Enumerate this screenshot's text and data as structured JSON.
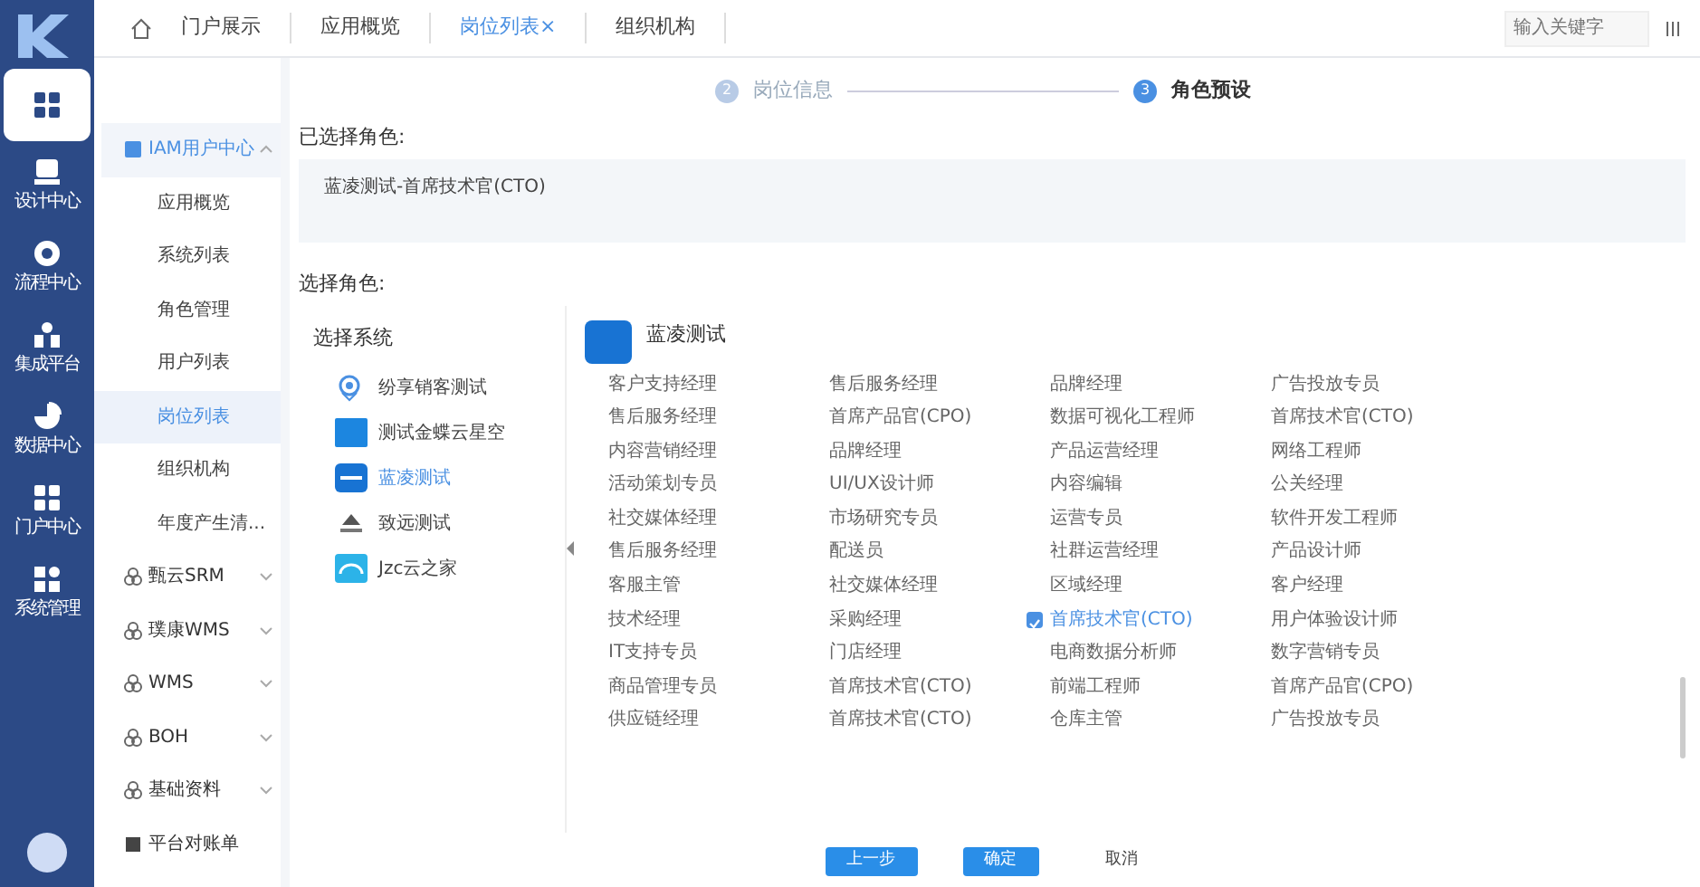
{
  "rail": {
    "items": [
      {
        "selected": true
      },
      {
        "label": "设计中心",
        "selected": false
      },
      {
        "label": "流程中心",
        "selected": false
      },
      {
        "label": "集成平台",
        "selected": false
      },
      {
        "label": "数据中心",
        "selected": false
      },
      {
        "label": "门户中心",
        "selected": false
      },
      {
        "label": "系统管理",
        "selected": false
      }
    ]
  },
  "tabs": [
    {
      "label": "门户展示",
      "selected": false
    },
    {
      "label": "应用概览",
      "selected": false
    },
    {
      "label": "岗位列表",
      "selected": true,
      "close": "×"
    },
    {
      "label": "组织机构",
      "selected": false
    }
  ],
  "search": {
    "placeholder": "输入关键字"
  },
  "sidebar": {
    "items": [
      {
        "label": "IAM用户中心",
        "expanded": true,
        "children": [
          {
            "label": "应用概览",
            "selected": false
          },
          {
            "label": "系统列表",
            "selected": false
          },
          {
            "label": "角色管理",
            "selected": false
          },
          {
            "label": "用户列表",
            "selected": false
          },
          {
            "label": "岗位列表",
            "selected": true
          },
          {
            "label": "组织机构",
            "selected": false
          },
          {
            "label": "年度产生清...",
            "selected": false
          }
        ]
      },
      {
        "label": "甄云SRM",
        "expanded": false
      },
      {
        "label": "璞康WMS",
        "expanded": false
      },
      {
        "label": "WMS",
        "expanded": false
      },
      {
        "label": "BOH",
        "expanded": false
      },
      {
        "label": "基础资料",
        "expanded": false
      },
      {
        "label": "平台对账单",
        "expanded": false
      }
    ]
  },
  "steps": [
    {
      "number": "2",
      "label": "岗位信息",
      "selected": false
    },
    {
      "number": "3",
      "label": "角色预设",
      "selected": true
    }
  ],
  "selected_roles": {
    "label": "已选择角色:",
    "items": [
      "蓝凌测试-首席技术官(CTO)"
    ]
  },
  "choose_label": "选择角色:",
  "systems": {
    "title": "选择系统",
    "items": [
      {
        "label": "纷享销客测试",
        "selected": false
      },
      {
        "label": "测试金蝶云星空",
        "selected": false
      },
      {
        "label": "蓝凌测试",
        "selected": true
      },
      {
        "label": "致远测试",
        "selected": false
      },
      {
        "label": "Jzc云之家",
        "selected": false
      }
    ]
  },
  "role_panel": {
    "title": "蓝凌测试",
    "roles": [
      {
        "label": "客户支持经理",
        "checked": false
      },
      {
        "label": "售后服务经理",
        "checked": false
      },
      {
        "label": "品牌经理",
        "checked": false
      },
      {
        "label": "广告投放专员",
        "checked": false
      },
      {
        "label": "售后服务经理",
        "checked": false
      },
      {
        "label": "首席产品官(CPO)",
        "checked": false
      },
      {
        "label": "数据可视化工程师",
        "checked": false
      },
      {
        "label": "首席技术官(CTO)",
        "checked": false
      },
      {
        "label": "内容营销经理",
        "checked": false
      },
      {
        "label": "品牌经理",
        "checked": false
      },
      {
        "label": "产品运营经理",
        "checked": false
      },
      {
        "label": "网络工程师",
        "checked": false
      },
      {
        "label": "活动策划专员",
        "checked": false
      },
      {
        "label": "UI/UX设计师",
        "checked": false
      },
      {
        "label": "内容编辑",
        "checked": false
      },
      {
        "label": "公关经理",
        "checked": false
      },
      {
        "label": "社交媒体经理",
        "checked": false
      },
      {
        "label": "市场研究专员",
        "checked": false
      },
      {
        "label": "运营专员",
        "checked": false
      },
      {
        "label": "软件开发工程师",
        "checked": false
      },
      {
        "label": "售后服务经理",
        "checked": false
      },
      {
        "label": "配送员",
        "checked": false
      },
      {
        "label": "社群运营经理",
        "checked": false
      },
      {
        "label": "产品设计师",
        "checked": false
      },
      {
        "label": "客服主管",
        "checked": false
      },
      {
        "label": "社交媒体经理",
        "checked": false
      },
      {
        "label": "区域经理",
        "checked": false
      },
      {
        "label": "客户经理",
        "checked": false
      },
      {
        "label": "技术经理",
        "checked": false
      },
      {
        "label": "采购经理",
        "checked": false
      },
      {
        "label": "首席技术官(CTO)",
        "checked": true
      },
      {
        "label": "用户体验设计师",
        "checked": false
      },
      {
        "label": "IT支持专员",
        "checked": false
      },
      {
        "label": "门店经理",
        "checked": false
      },
      {
        "label": "电商数据分析师",
        "checked": false
      },
      {
        "label": "数字营销专员",
        "checked": false
      },
      {
        "label": "商品管理专员",
        "checked": false
      },
      {
        "label": "首席技术官(CTO)",
        "checked": false
      },
      {
        "label": "前端工程师",
        "checked": false
      },
      {
        "label": "首席产品官(CPO)",
        "checked": false
      },
      {
        "label": "供应链经理",
        "checked": false
      },
      {
        "label": "首席技术官(CTO)",
        "checked": false
      },
      {
        "label": "仓库主管",
        "checked": false
      },
      {
        "label": "广告投放专员",
        "checked": false
      }
    ]
  },
  "buttons": [
    {
      "label": "上一步",
      "kind": "primary"
    },
    {
      "label": "确定",
      "kind": "primary"
    },
    {
      "label": "取消",
      "kind": "plain"
    }
  ]
}
